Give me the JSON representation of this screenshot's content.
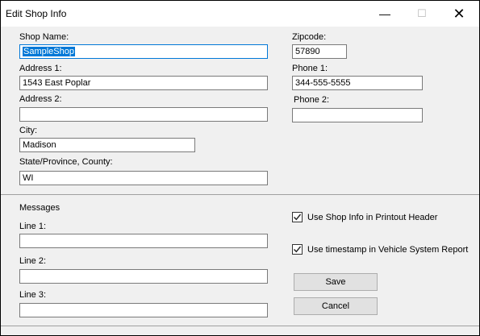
{
  "window": {
    "title": "Edit Shop Info",
    "controls": {
      "minimize": "—",
      "maximize": "☐",
      "close": "✕"
    }
  },
  "shop": {
    "shop_name_label": "Shop Name:",
    "shop_name_value": "SampleShop",
    "address1_label": "Address 1:",
    "address1_value": "1543 East Poplar",
    "address2_label": "Address 2:",
    "address2_value": "",
    "city_label": "City:",
    "city_value": "Madison",
    "state_label": "State/Province, County:",
    "state_value": "WI",
    "zipcode_label": "Zipcode:",
    "zipcode_value": "57890",
    "phone1_label": "Phone 1:",
    "phone1_value": "344-555-5555",
    "phone2_label": "Phone 2:",
    "phone2_value": ""
  },
  "messages": {
    "heading": "Messages",
    "line1_label": "Line 1:",
    "line1_value": "",
    "line2_label": "Line 2:",
    "line2_value": "",
    "line3_label": "Line 3:",
    "line3_value": ""
  },
  "options": {
    "use_shop_info_label": "Use Shop Info in Printout Header",
    "use_shop_info_checked": true,
    "use_timestamp_label": "Use timestamp in Vehicle System Report",
    "use_timestamp_checked": true
  },
  "actions": {
    "save_label": "Save",
    "cancel_label": "Cancel"
  }
}
